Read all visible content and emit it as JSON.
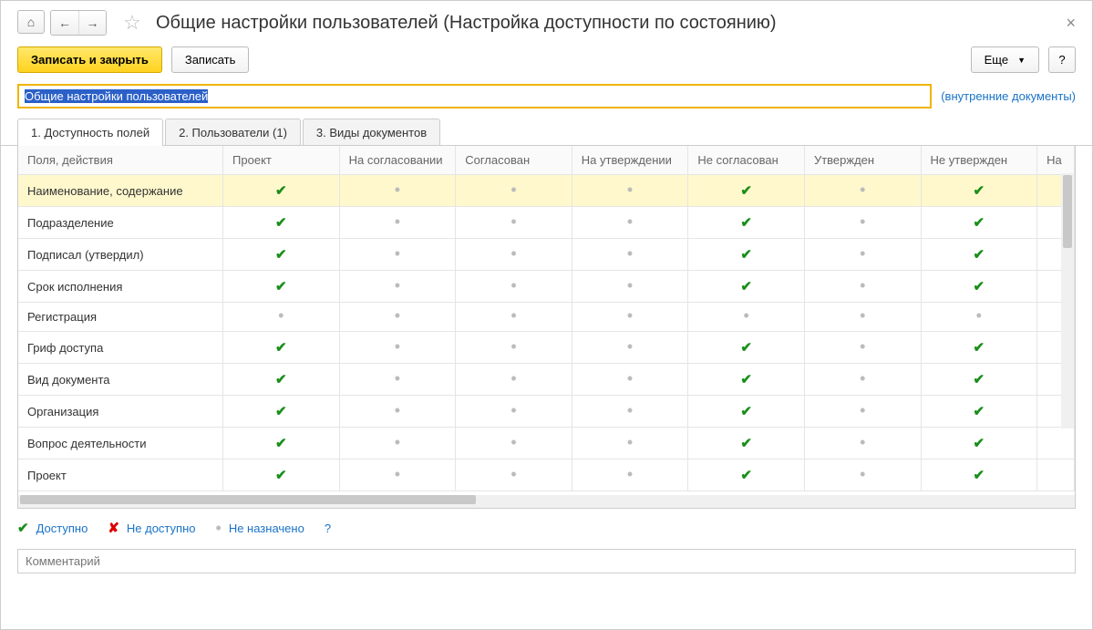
{
  "title": "Общие настройки пользователей (Настройка доступности по состоянию)",
  "toolbar": {
    "save_close": "Записать и закрыть",
    "save": "Записать",
    "more": "Еще",
    "help": "?"
  },
  "name_field": {
    "value": "Общие настройки пользователей"
  },
  "internal_docs": "(внутренние документы)",
  "tabs": {
    "t1": "1. Доступность полей",
    "t2": "2. Пользователи (1)",
    "t3": "3. Виды документов"
  },
  "grid": {
    "headers": [
      "Поля, действия",
      "Проект",
      "На согласовании",
      "Согласован",
      "На утверждении",
      "Не согласован",
      "Утвержден",
      "Не утвержден",
      "На"
    ],
    "rows": [
      {
        "label": "Наименование, содержание",
        "cells": [
          "check",
          "dot",
          "dot",
          "dot",
          "check",
          "dot",
          "check"
        ],
        "hl": true
      },
      {
        "label": "Подразделение",
        "cells": [
          "check",
          "dot",
          "dot",
          "dot",
          "check",
          "dot",
          "check"
        ]
      },
      {
        "label": "Подписал (утвердил)",
        "cells": [
          "check",
          "dot",
          "dot",
          "dot",
          "check",
          "dot",
          "check"
        ]
      },
      {
        "label": "Срок исполнения",
        "cells": [
          "check",
          "dot",
          "dot",
          "dot",
          "check",
          "dot",
          "check"
        ]
      },
      {
        "label": "Регистрация",
        "cells": [
          "dot",
          "dot",
          "dot",
          "dot",
          "dot",
          "dot",
          "dot"
        ]
      },
      {
        "label": "Гриф доступа",
        "cells": [
          "check",
          "dot",
          "dot",
          "dot",
          "check",
          "dot",
          "check"
        ]
      },
      {
        "label": "Вид документа",
        "cells": [
          "check",
          "dot",
          "dot",
          "dot",
          "check",
          "dot",
          "check"
        ]
      },
      {
        "label": "Организация",
        "cells": [
          "check",
          "dot",
          "dot",
          "dot",
          "check",
          "dot",
          "check"
        ]
      },
      {
        "label": "Вопрос деятельности",
        "cells": [
          "check",
          "dot",
          "dot",
          "dot",
          "check",
          "dot",
          "check"
        ]
      },
      {
        "label": "Проект",
        "cells": [
          "check",
          "dot",
          "dot",
          "dot",
          "check",
          "dot",
          "check"
        ]
      }
    ]
  },
  "legend": {
    "available": "Доступно",
    "not_available": "Не доступно",
    "not_assigned": "Не назначено",
    "q": "?"
  },
  "comment": {
    "placeholder": "Комментарий"
  }
}
